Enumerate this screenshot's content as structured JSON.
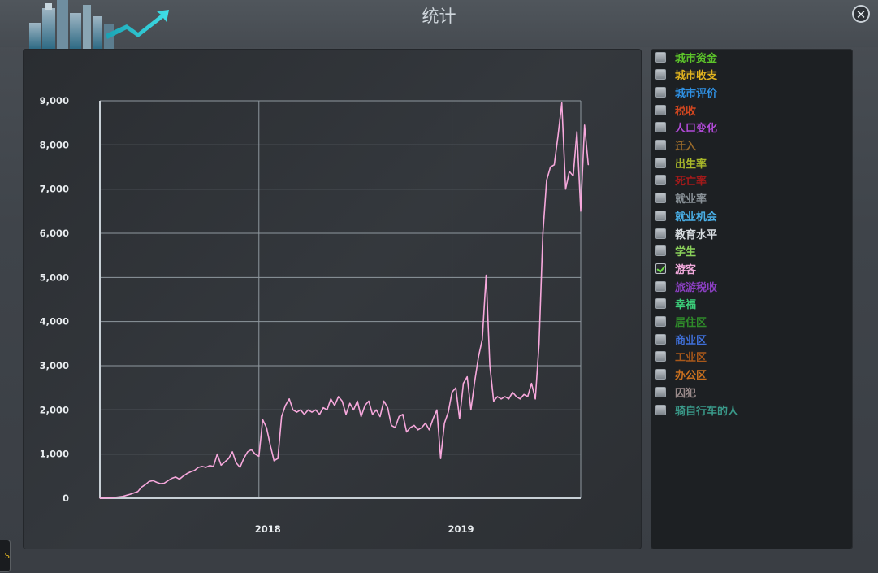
{
  "window": {
    "title": "统计",
    "close_icon": "close-icon"
  },
  "side_tab": {
    "text": "S"
  },
  "legend": {
    "items": [
      {
        "label": "城市资金",
        "color": "#5cc42a",
        "checked": false
      },
      {
        "label": "城市收支",
        "color": "#e0b31f",
        "checked": false
      },
      {
        "label": "城市评价",
        "color": "#2f8fe0",
        "checked": false
      },
      {
        "label": "税收",
        "color": "#d0461f",
        "checked": false
      },
      {
        "label": "人口变化",
        "color": "#b04ad6",
        "checked": false
      },
      {
        "label": "迁入",
        "color": "#9a6a2a",
        "checked": false
      },
      {
        "label": "出生率",
        "color": "#a9b82a",
        "checked": false
      },
      {
        "label": "死亡率",
        "color": "#a31a1a",
        "checked": false
      },
      {
        "label": "就业率",
        "color": "#8a9298",
        "checked": false
      },
      {
        "label": "就业机会",
        "color": "#4ab0e8",
        "checked": false
      },
      {
        "label": "教育水平",
        "color": "#d8dde1",
        "checked": false
      },
      {
        "label": "学生",
        "color": "#8ad05a",
        "checked": false
      },
      {
        "label": "游客",
        "color": "#f2a9dc",
        "checked": true
      },
      {
        "label": "旅游税收",
        "color": "#8a3fc0",
        "checked": false
      },
      {
        "label": "幸福",
        "color": "#3ccf7a",
        "checked": false
      },
      {
        "label": "居住区",
        "color": "#2f8a2a",
        "checked": false
      },
      {
        "label": "商业区",
        "color": "#3f6fd8",
        "checked": false
      },
      {
        "label": "工业区",
        "color": "#a8581a",
        "checked": false
      },
      {
        "label": "办公区",
        "color": "#c8701f",
        "checked": false
      },
      {
        "label": "囚犯",
        "color": "#9a8a8a",
        "checked": false
      },
      {
        "label": "骑自行车的人",
        "color": "#3a9a8a",
        "checked": false
      }
    ]
  },
  "chart_data": {
    "type": "line",
    "series": [
      {
        "name": "游客",
        "color": "#f7a8dc",
        "points": [
          [
            0,
            0
          ],
          [
            3,
            10
          ],
          [
            6,
            40
          ],
          [
            8,
            90
          ],
          [
            10,
            150
          ],
          [
            11,
            250
          ],
          [
            12,
            310
          ],
          [
            13,
            380
          ],
          [
            14,
            400
          ],
          [
            15,
            360
          ],
          [
            16,
            330
          ],
          [
            17,
            340
          ],
          [
            18,
            400
          ],
          [
            19,
            450
          ],
          [
            20,
            480
          ],
          [
            21,
            430
          ],
          [
            22,
            500
          ],
          [
            23,
            560
          ],
          [
            24,
            600
          ],
          [
            25,
            630
          ],
          [
            26,
            700
          ],
          [
            27,
            720
          ],
          [
            28,
            700
          ],
          [
            29,
            740
          ],
          [
            30,
            720
          ],
          [
            31,
            1000
          ],
          [
            32,
            750
          ],
          [
            33,
            820
          ],
          [
            34,
            900
          ],
          [
            35,
            1050
          ],
          [
            36,
            800
          ],
          [
            37,
            700
          ],
          [
            38,
            900
          ],
          [
            39,
            1050
          ],
          [
            40,
            1100
          ],
          [
            41,
            1000
          ],
          [
            42,
            950
          ],
          [
            43,
            1780
          ],
          [
            44,
            1600
          ],
          [
            45,
            1200
          ],
          [
            46,
            850
          ],
          [
            47,
            900
          ],
          [
            48,
            1850
          ],
          [
            49,
            2100
          ],
          [
            50,
            2250
          ],
          [
            51,
            2000
          ],
          [
            52,
            1950
          ],
          [
            53,
            2000
          ],
          [
            54,
            1900
          ],
          [
            55,
            2000
          ],
          [
            56,
            1950
          ],
          [
            57,
            2000
          ],
          [
            58,
            1900
          ],
          [
            59,
            2050
          ],
          [
            60,
            2000
          ],
          [
            61,
            2250
          ],
          [
            62,
            2100
          ],
          [
            63,
            2300
          ],
          [
            64,
            2200
          ],
          [
            65,
            1900
          ],
          [
            66,
            2150
          ],
          [
            67,
            2000
          ],
          [
            68,
            2200
          ],
          [
            69,
            1850
          ],
          [
            70,
            2100
          ],
          [
            71,
            2200
          ],
          [
            72,
            1900
          ],
          [
            73,
            2000
          ],
          [
            74,
            1850
          ],
          [
            75,
            2200
          ],
          [
            76,
            2050
          ],
          [
            77,
            1650
          ],
          [
            78,
            1600
          ],
          [
            79,
            1850
          ],
          [
            80,
            1900
          ],
          [
            81,
            1500
          ],
          [
            82,
            1600
          ],
          [
            83,
            1650
          ],
          [
            84,
            1550
          ],
          [
            85,
            1600
          ],
          [
            86,
            1700
          ],
          [
            87,
            1550
          ],
          [
            88,
            1800
          ],
          [
            89,
            2000
          ],
          [
            90,
            900
          ],
          [
            91,
            1700
          ],
          [
            92,
            1950
          ],
          [
            93,
            2400
          ],
          [
            94,
            2500
          ],
          [
            95,
            1800
          ],
          [
            96,
            2600
          ],
          [
            97,
            2750
          ],
          [
            98,
            2000
          ],
          [
            99,
            2650
          ],
          [
            100,
            3200
          ],
          [
            101,
            3600
          ],
          [
            102,
            5050
          ],
          [
            103,
            3000
          ],
          [
            104,
            2200
          ],
          [
            105,
            2300
          ],
          [
            106,
            2250
          ],
          [
            107,
            2300
          ],
          [
            108,
            2250
          ],
          [
            109,
            2400
          ],
          [
            110,
            2300
          ],
          [
            111,
            2250
          ],
          [
            112,
            2350
          ],
          [
            113,
            2300
          ],
          [
            114,
            2600
          ],
          [
            115,
            2250
          ],
          [
            116,
            3500
          ],
          [
            117,
            6000
          ],
          [
            118,
            7200
          ],
          [
            119,
            7500
          ],
          [
            120,
            7550
          ],
          [
            121,
            8200
          ],
          [
            122,
            8950
          ],
          [
            123,
            7000
          ],
          [
            124,
            7400
          ],
          [
            125,
            7300
          ],
          [
            126,
            8300
          ],
          [
            127,
            6500
          ],
          [
            128,
            8450
          ],
          [
            129,
            7550
          ]
        ]
      }
    ],
    "x_ticks": [
      {
        "label": "2018",
        "x": 42
      },
      {
        "label": "2019",
        "x": 93
      }
    ],
    "xlim": [
      0,
      127
    ],
    "y_ticks": [
      "0",
      "1,000",
      "2,000",
      "3,000",
      "4,000",
      "5,000",
      "6,000",
      "7,000",
      "8,000",
      "9,000"
    ],
    "ylim": [
      0,
      9000
    ],
    "grid": true
  }
}
